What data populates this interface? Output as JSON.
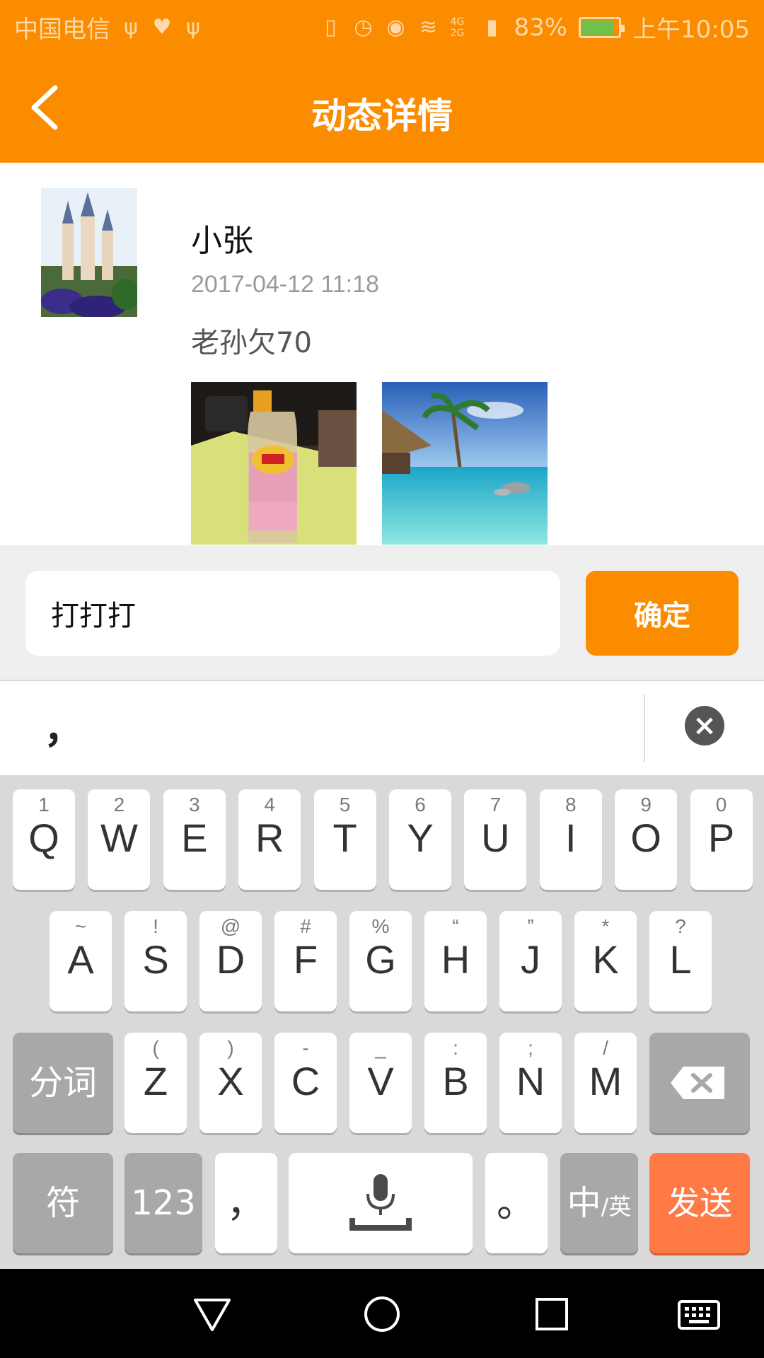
{
  "status_bar": {
    "carrier": "中国电信",
    "battery": "83%",
    "time": "上午10:05",
    "network": "4G 2G"
  },
  "app_bar": {
    "title": "动态详情",
    "back_icon": "chevron-left-icon"
  },
  "post": {
    "username": "小张",
    "timestamp": "2017-04-12 11:18",
    "text": "老孙欠70",
    "avatar": "castle-photo",
    "photos": [
      "bottle-photo",
      "beach-photo"
    ]
  },
  "comment_bar": {
    "input_value": "打打打",
    "confirm_label": "确定"
  },
  "candidates": {
    "first": "，",
    "close_icon": "close-circle-icon"
  },
  "keyboard": {
    "row1": [
      {
        "hint": "1",
        "key": "Q"
      },
      {
        "hint": "2",
        "key": "W"
      },
      {
        "hint": "3",
        "key": "E"
      },
      {
        "hint": "4",
        "key": "R"
      },
      {
        "hint": "5",
        "key": "T"
      },
      {
        "hint": "6",
        "key": "Y"
      },
      {
        "hint": "7",
        "key": "U"
      },
      {
        "hint": "8",
        "key": "I"
      },
      {
        "hint": "9",
        "key": "O"
      },
      {
        "hint": "0",
        "key": "P"
      }
    ],
    "row2": [
      {
        "hint": "~",
        "key": "A"
      },
      {
        "hint": "!",
        "key": "S"
      },
      {
        "hint": "@",
        "key": "D"
      },
      {
        "hint": "#",
        "key": "F"
      },
      {
        "hint": "%",
        "key": "G"
      },
      {
        "hint": "“",
        "key": "H"
      },
      {
        "hint": "”",
        "key": "J"
      },
      {
        "hint": "*",
        "key": "K"
      },
      {
        "hint": "?",
        "key": "L"
      }
    ],
    "row3": [
      {
        "hint": "(",
        "key": "Z"
      },
      {
        "hint": ")",
        "key": "X"
      },
      {
        "hint": "-",
        "key": "C"
      },
      {
        "hint": "_",
        "key": "V"
      },
      {
        "hint": ":",
        "key": "B"
      },
      {
        "hint": ";",
        "key": "N"
      },
      {
        "hint": "/",
        "key": "M"
      }
    ],
    "segment_label": "分词",
    "symbol_label": "符",
    "numbers_label": "123",
    "comma_label": "，",
    "period_label": "。",
    "lang_label": "中",
    "lang_sub_label": "/英",
    "send_label": "发送",
    "backspace_icon": "backspace-icon",
    "mic_icon": "microphone-icon"
  },
  "nav_bar": {
    "back": "triangle-back-icon",
    "home": "circle-home-icon",
    "recents": "square-recents-icon",
    "keyboard": "keyboard-icon"
  }
}
